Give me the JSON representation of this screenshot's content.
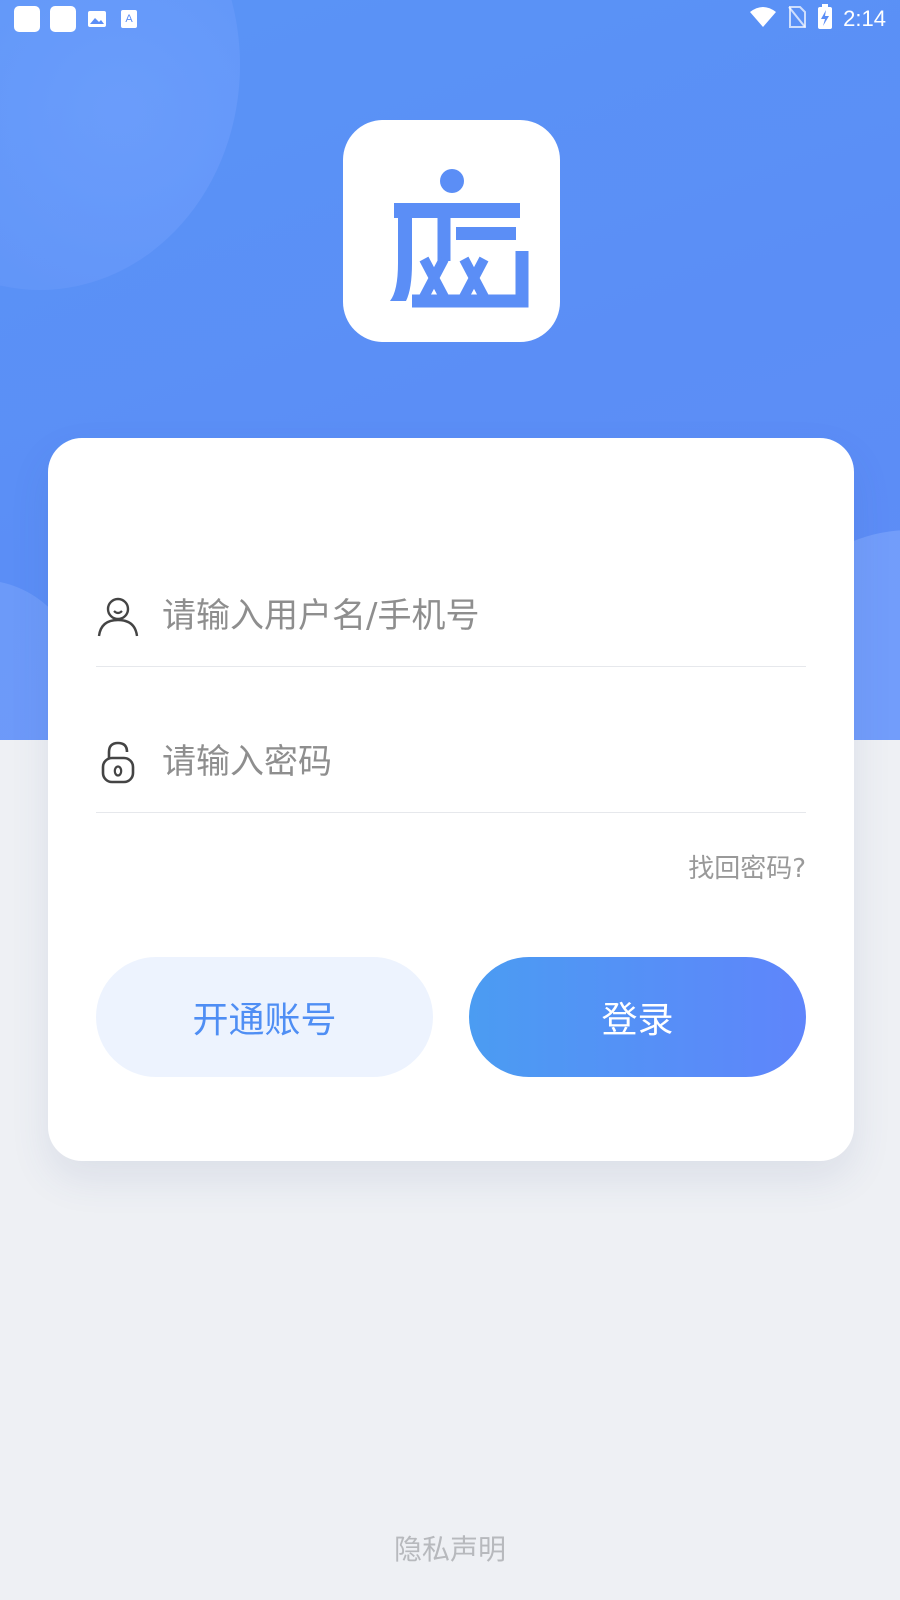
{
  "status_bar": {
    "time": "2:14",
    "icons": [
      "app-notification-icon",
      "app-notification-icon",
      "image-icon",
      "text-icon",
      "wifi-icon",
      "no-sim-icon",
      "battery-charging-icon"
    ]
  },
  "logo": {
    "char": "庿",
    "accent_color": "#5b8ef6"
  },
  "login_form": {
    "username_placeholder": "请输入用户名/手机号",
    "password_placeholder": "请输入密码",
    "forgot_password": "找回密码?",
    "register_label": "开通账号",
    "login_label": "登录"
  },
  "footer": {
    "privacy_label": "隐私声明"
  },
  "colors": {
    "brand_blue": "#5b8ef6",
    "login_gradient_start": "#4b9cf2",
    "login_gradient_end": "#5f85fb",
    "register_bg": "#edf3fe",
    "page_bg": "#eef0f4"
  }
}
